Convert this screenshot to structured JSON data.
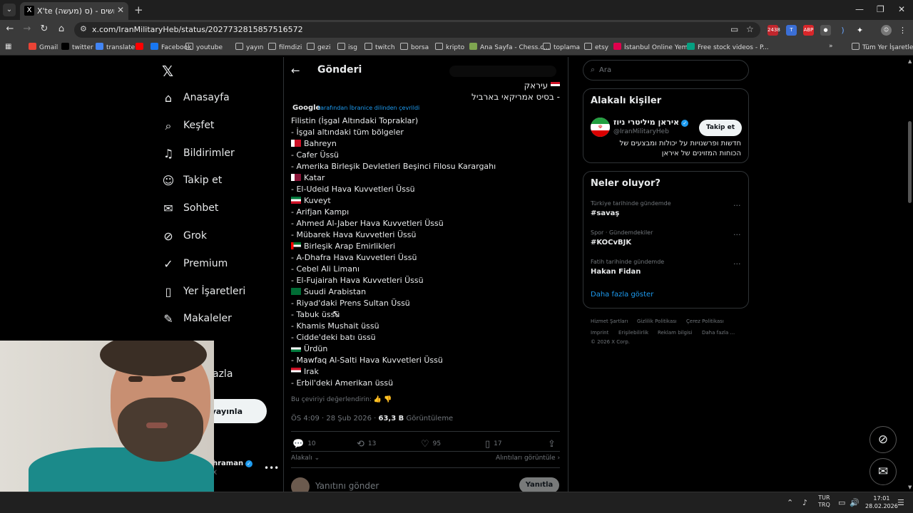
{
  "browser": {
    "tab_title": "X'te (מעשה) כל השטחים הכבושים - (ס...",
    "tab_favicon": "X",
    "url": "x.com/IranMilitaryHeb/status/2027732815857516572",
    "bookmarks": [
      {
        "label": "Gmail",
        "icon": "gmail-icon",
        "color": "#ea4335"
      },
      {
        "label": "twitter",
        "icon": "x-icon",
        "color": "#000000"
      },
      {
        "label": "translate",
        "icon": "translate-icon",
        "color": "#4285f4"
      },
      {
        "label": "",
        "icon": "youtube-icon",
        "color": "#ff0000"
      },
      {
        "label": "Facebook",
        "icon": "facebook-icon",
        "color": "#1877f2"
      },
      {
        "label": "youtube",
        "icon": "folder-icon",
        "color": ""
      },
      {
        "label": "yayın",
        "icon": "folder-icon",
        "color": ""
      },
      {
        "label": "filmdizi",
        "icon": "folder-icon",
        "color": ""
      },
      {
        "label": "gezi",
        "icon": "folder-icon",
        "color": ""
      },
      {
        "label": "isg",
        "icon": "folder-icon",
        "color": ""
      },
      {
        "label": "twitch",
        "icon": "folder-icon",
        "color": ""
      },
      {
        "label": "borsa",
        "icon": "folder-icon",
        "color": ""
      },
      {
        "label": "kripto",
        "icon": "folder-icon",
        "color": ""
      },
      {
        "label": "Ana Sayfa - Chess.c...",
        "icon": "chess-icon",
        "color": "#7fa650"
      },
      {
        "label": "toplama",
        "icon": "folder-icon",
        "color": ""
      },
      {
        "label": "etsy",
        "icon": "folder-icon",
        "color": ""
      },
      {
        "label": "İstanbul Online Yem...",
        "icon": "yemeksepeti-icon",
        "color": "#e0004d"
      },
      {
        "label": "Free stock videos - P...",
        "icon": "pexels-icon",
        "color": "#05a081"
      }
    ],
    "all_bookmarks": "Tüm Yer İşaretleri",
    "ext_badge": "2438"
  },
  "sidebar": {
    "items": [
      {
        "label": "Anasayfa",
        "icon": "home-icon",
        "glyph": "⌂"
      },
      {
        "label": "Keşfet",
        "icon": "search-icon",
        "glyph": "⌕"
      },
      {
        "label": "Bildirimler",
        "icon": "bell-icon",
        "glyph": "♫"
      },
      {
        "label": "Takip et",
        "icon": "add-person-icon",
        "glyph": "☺"
      },
      {
        "label": "Sohbet",
        "icon": "mail-icon",
        "glyph": "✉"
      },
      {
        "label": "Grok",
        "icon": "grok-icon",
        "glyph": "⊘"
      },
      {
        "label": "Premium",
        "icon": "premium-icon",
        "glyph": "✓"
      },
      {
        "label": "Yer İşaretleri",
        "icon": "bookmark-icon",
        "glyph": "▯"
      },
      {
        "label": "Makaleler",
        "icon": "article-icon",
        "glyph": "✎"
      }
    ],
    "more_label": "azla",
    "publish_label": "yayınla",
    "account_name": "hraman",
    "account_handle": "X"
  },
  "post": {
    "header": "Gönderi",
    "hebrew_lines": [
      "עיראק",
      "- בסיס אמריקאי בארביל"
    ],
    "google_label": "Google",
    "translated_by": "tarafından İbranice dilinden çevrildi",
    "lines": [
      {
        "text": "Filistin (İşgal Altındaki Topraklar)",
        "flag": ""
      },
      {
        "text": "- İşgal altındaki tüm bölgeler",
        "flag": ""
      },
      {
        "text": "Bahreyn",
        "flag": "bahrain"
      },
      {
        "text": "- Cafer Üssü",
        "flag": ""
      },
      {
        "text": "- Amerika Birleşik Devletleri Beşinci Filosu Karargahı",
        "flag": ""
      },
      {
        "text": "Katar",
        "flag": "qatar"
      },
      {
        "text": "- El-Udeid Hava Kuvvetleri Üssü",
        "flag": ""
      },
      {
        "text": "Kuveyt",
        "flag": "kuwait"
      },
      {
        "text": "- Arifjan Kampı",
        "flag": ""
      },
      {
        "text": "- Ahmed Al-Jaber Hava Kuvvetleri Üssü",
        "flag": ""
      },
      {
        "text": "- Mübarek Hava Kuvvetleri Üssü",
        "flag": ""
      },
      {
        "text": "Birleşik Arap Emirlikleri",
        "flag": "uae"
      },
      {
        "text": "- A-Dhafra Hava Kuvvetleri Üssü",
        "flag": ""
      },
      {
        "text": "- Cebel Ali Limanı",
        "flag": ""
      },
      {
        "text": "- El-Fujairah Hava Kuvvetleri Üssü",
        "flag": ""
      },
      {
        "text": "Suudi Arabistan",
        "flag": "saudi"
      },
      {
        "text": "- Riyad'daki Prens Sultan Üssü",
        "flag": ""
      },
      {
        "text": "- Tabuk üssü",
        "flag": ""
      },
      {
        "text": "- Khamis Mushait üssü",
        "flag": ""
      },
      {
        "text": "- Cidde'deki batı üssü",
        "flag": ""
      },
      {
        "text": "Ürdün",
        "flag": "jordan"
      },
      {
        "text": "- Mawfaq Al-Salti Hava Kuvvetleri Üssü",
        "flag": ""
      },
      {
        "text": "Irak",
        "flag": "iraq"
      },
      {
        "text": "- Erbil'deki Amerikan üssü",
        "flag": ""
      }
    ],
    "rate_translation": "Bu çeviriyi değerlendirin:",
    "timestamp": "ÖS 4:09 · 28 Şub 2026 ·",
    "views_count": "63,3 B",
    "views_label": "Görüntüleme",
    "replies": "10",
    "reposts": "13",
    "likes": "95",
    "bookmarks": "17",
    "relevant": "Alakalı",
    "quotes": "Alıntıları görüntüle",
    "reply_placeholder": "Yanıtını gönder",
    "reply_button": "Yanıtla"
  },
  "right": {
    "search_placeholder": "Ara",
    "people_title": "Alakalı kişiler",
    "person_name": "איראן מיליטרי ניוז",
    "person_handle": "@IranMilitaryHeb",
    "follow_label": "Takip et",
    "person_bio": "חדשות ופרשנויות על יכולות ומבצעים של הכוחות המזוינים של איראן",
    "trends_title": "Neler oluyor?",
    "trends": [
      {
        "context": "Türkiye tarihinde gündemde",
        "name": "#savaş"
      },
      {
        "context": "Spor · Gündemdekiler",
        "name": "#KOCvBJK"
      },
      {
        "context": "Fatih tarihinde gündemde",
        "name": "Hakan Fidan"
      }
    ],
    "show_more": "Daha fazla göster",
    "footer": [
      "Hizmet Şartları",
      "Gizlilik Politikası",
      "Çerez Politikası",
      "Imprint",
      "Erişilebilirlik",
      "Reklam bilgisi",
      "Daha fazla ...",
      "© 2026 X Corp."
    ]
  },
  "taskbar": {
    "lang1": "TUR",
    "lang2": "TRQ",
    "time": "17:01",
    "date": "28.02.2026"
  }
}
